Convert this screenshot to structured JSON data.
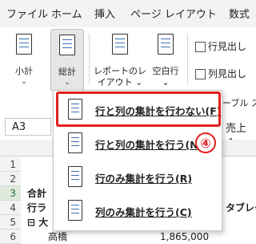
{
  "tabs": [
    "ファイル",
    "ホーム",
    "挿入",
    "ページ レイアウト",
    "数式"
  ],
  "ribbon": {
    "subtotal": {
      "label": "小計",
      "chevron": "⌄"
    },
    "grand_total": {
      "label": "総計",
      "chevron": "⌄"
    },
    "report_layout": {
      "label_line1": "レポートのレ",
      "label_line2": "イアウト ⌄"
    },
    "blank_row": {
      "label_line1": "空白行",
      "label_line2": "⌄"
    },
    "row_headers": "行見出し",
    "column_headers": "列見出し",
    "table_style_partial": "ーブル ス"
  },
  "name_box": "A3",
  "formula_partial": "売上金",
  "rows": [
    "1",
    "2",
    "3",
    "4",
    "5",
    "6"
  ],
  "cells": {
    "a3": "合計",
    "a4": "行ラ",
    "a5": "⊟ 大",
    "a6": "高橋",
    "e4": "タブレー",
    "e6": "1,865,000"
  },
  "menu": {
    "items": [
      {
        "label": "行と列の集計を行わない(",
        "accel": "F",
        "close": ")"
      },
      {
        "label": "行と列の集計を行う(",
        "accel": "N",
        "close": ")"
      },
      {
        "label": "行のみ集計を行う(",
        "accel": "R",
        "close": ")"
      },
      {
        "label": "列のみ集計を行う(",
        "accel": "C",
        "close": ")"
      }
    ]
  },
  "step_badge": "④",
  "colors": {
    "highlight": "#e0201f",
    "accent_icon": "#3b6fb6",
    "excel_green": "#1e6b3a"
  }
}
